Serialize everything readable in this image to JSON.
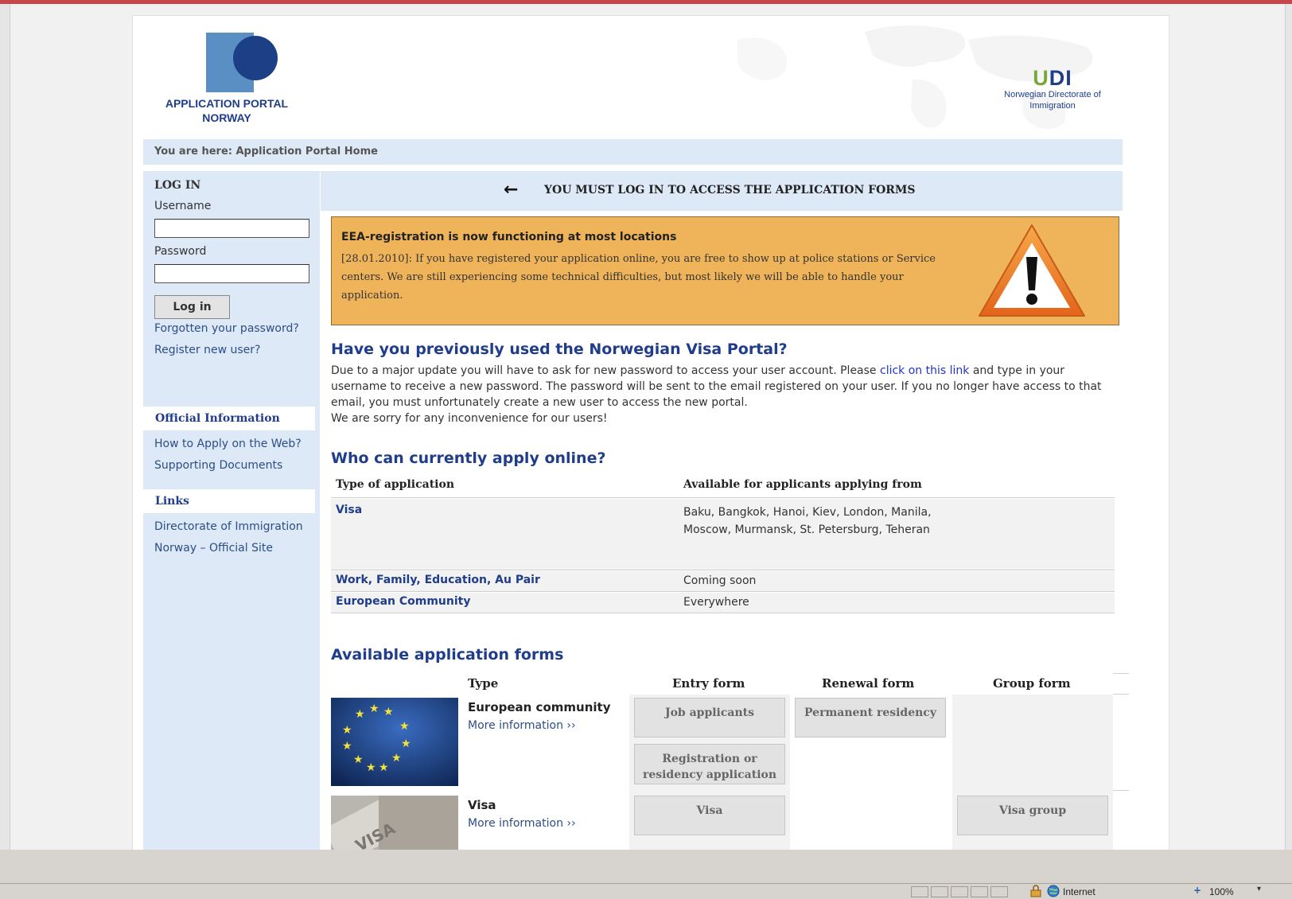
{
  "header": {
    "portal_title": "APPLICATION PORTAL NORWAY",
    "udi_logo": "UDI",
    "udi_subtitle": "Norwegian Directorate of Immigration"
  },
  "breadcrumb": "You are here: Application Portal Home",
  "login": {
    "heading": "LOG IN",
    "username_label": "Username",
    "username_value": "",
    "password_label": "Password",
    "password_value": "",
    "login_button": "Log in",
    "forgot_link": "Forgotten your password?",
    "register_link": "Register new user?"
  },
  "sidebar": {
    "official_heading": "Official Information",
    "official_links": [
      "How to Apply on the Web?",
      "Supporting Documents"
    ],
    "links_heading": "Links",
    "links": [
      "Directorate of Immigration",
      "Norway – Official Site"
    ]
  },
  "notice": {
    "arrow": "←",
    "text": "YOU MUST LOG IN TO ACCESS THE APPLICATION FORMS"
  },
  "alert": {
    "title": "EEA-registration is now functioning at most locations",
    "body": "[28.01.2010]: If you have registered your application online, you are free to show up at police stations or Service centers. We are still experiencing some technical difficulties, but most likely we will be able to handle your application."
  },
  "previous_portal": {
    "heading": "Have you previously used the Norwegian Visa Portal?",
    "text_before_link": "Due to a major update you will have to ask for new password to access your user account. Please ",
    "link_text": "click on this link",
    "text_after_link": " and type in your username to receive a new password. The password will be sent to the email registered on your user. If you no longer have access to that email, you must unfortunately create a new user to access the new portal.",
    "apology": "We are sorry for any inconvenience for our users!"
  },
  "who_can_apply": {
    "heading": "Who can currently apply online?",
    "columns": [
      "Type of application",
      "Available for applicants applying from"
    ],
    "rows": [
      {
        "type": "Visa",
        "from": "Baku, Bangkok, Hanoi, Kiev, London, Manila, Moscow, Murmansk, St. Petersburg, Teheran"
      },
      {
        "type": "Work, Family, Education, Au Pair",
        "from": "Coming soon"
      },
      {
        "type": "European Community",
        "from": "Everywhere"
      }
    ]
  },
  "forms": {
    "heading": "Available application forms",
    "columns": [
      "Type",
      "Entry form",
      "Renewal form",
      "Group form"
    ],
    "rows": [
      {
        "type": "European community",
        "more": "More information ››",
        "entry": [
          "Job applicants",
          "Registration or residency application"
        ],
        "renewal": [
          "Permanent residency"
        ],
        "group": []
      },
      {
        "type": "Visa",
        "more": "More information ››",
        "entry": [
          "Visa"
        ],
        "renewal": [],
        "group": [
          "Visa group"
        ]
      }
    ]
  },
  "statusbar": {
    "zone": "Internet",
    "zoom": "100%"
  },
  "colors": {
    "brand_blue": "#1f3d8a",
    "panel_blue": "#dde9f7",
    "alert_orange": "#efb45a",
    "link_blue": "#2233cc"
  }
}
